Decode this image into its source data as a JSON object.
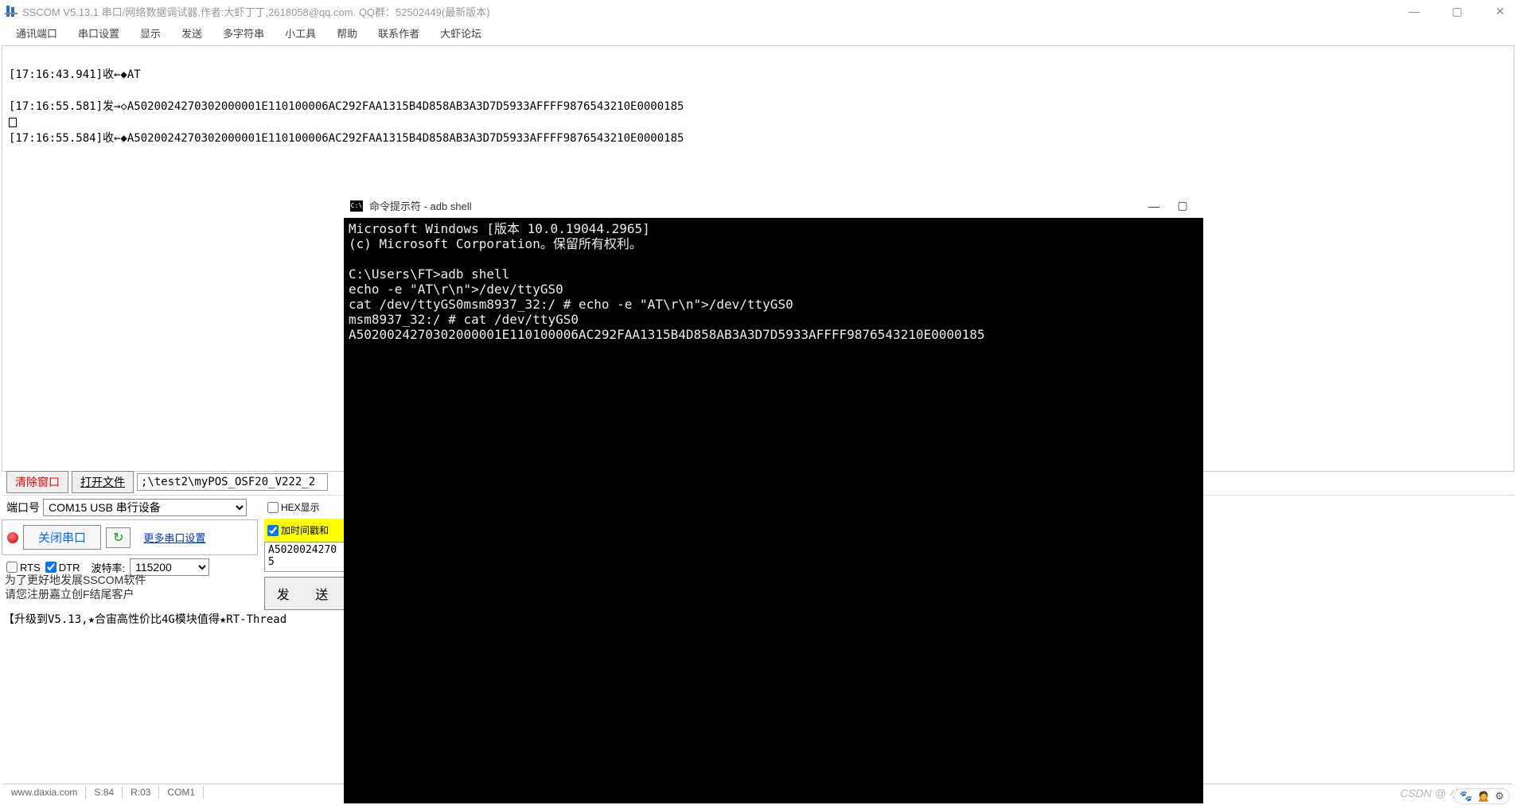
{
  "sscom": {
    "title": "SSCOM V5.13.1 串口/网络数据调试器,作者:大虾丁丁,2618058@qq.com. QQ群：52502449(最新版本)",
    "menus": [
      "通讯端口",
      "串口设置",
      "显示",
      "发送",
      "多字符串",
      "小工具",
      "帮助",
      "联系作者",
      "大虾论坛"
    ],
    "log_lines": [
      "[17:16:43.941]收←◆AT",
      "",
      "[17:16:55.581]发→◇A5020024270302000001E110100006AC292FAA1315B4D858AB3A3D7D5933AFFFF9876543210E0000185",
      "□",
      "[17:16:55.584]收←◆A5020024270302000001E110100006AC292FAA1315B4D858AB3A3D7D5933AFFFF9876543210E0000185"
    ],
    "clear_btn": "清除窗口",
    "open_file_btn": "打开文件",
    "file_path": ";\\test2\\myPOS_OSF20_V222_2",
    "port_label": "端口号",
    "port_value": "COM15 USB 串行设备",
    "hex_display": "HEX显示",
    "close_port": "关闭串口",
    "more_settings": "更多串口设置",
    "timestamp_chk": "加时间戳和",
    "rts": "RTS",
    "dtr": "DTR",
    "baud_label": "波特率:",
    "baud_value": "115200",
    "data_box": "A5020024270\n5",
    "send_btn": "发 送",
    "promo1": "为了更好地发展SSCOM软件",
    "promo2": "请您注册嘉立创F结尾客户",
    "promo3": "【升级到V5.13,★合宙高性价比4G模块值得★RT-Thread",
    "status": {
      "c0": "www.daxia.com",
      "c1": "S:84",
      "c2": "R:03",
      "c3": "COM1"
    }
  },
  "cmd": {
    "title": "命令提示符 - adb  shell",
    "lines": [
      "Microsoft Windows [版本 10.0.19044.2965]",
      "(c) Microsoft Corporation。保留所有权利。",
      "",
      "C:\\Users\\FT>adb shell",
      "echo -e \"AT\\r\\n\">/dev/ttyGS0",
      "cat /dev/ttyGS0msm8937_32:/ # echo -e \"AT\\r\\n\">/dev/ttyGS0",
      "msm8937_32:/ # cat /dev/ttyGS0",
      "A5020024270302000001E110100006AC292FAA1315B4D858AB3A3D7D5933AFFFF9876543210E0000185"
    ]
  },
  "watermark": "CSDN @ 小黄人软件"
}
